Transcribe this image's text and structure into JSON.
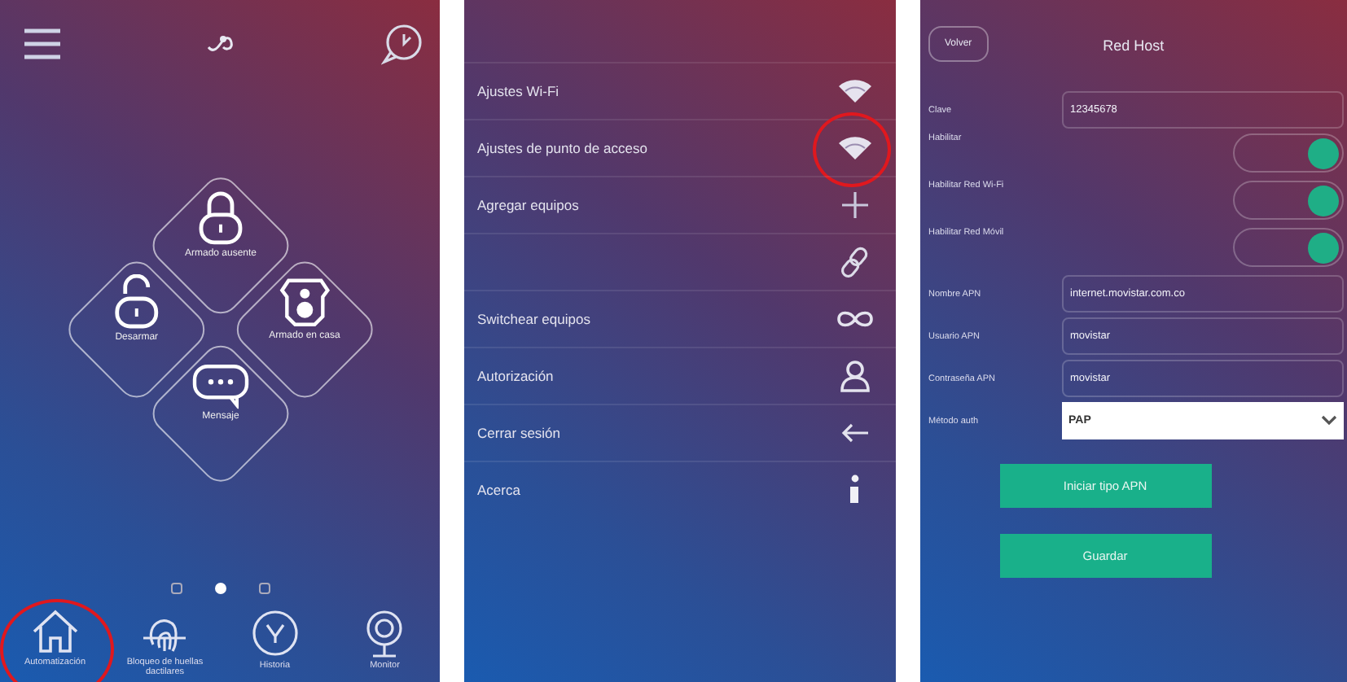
{
  "home": {
    "tiles": [
      {
        "label": "Armado ausente",
        "kind": "lock"
      },
      {
        "label": "Desarmar",
        "kind": "unlock"
      },
      {
        "label": "Armado en casa",
        "kind": "home-arm"
      },
      {
        "label": "Mensaje",
        "kind": "message"
      }
    ],
    "pager": [
      {
        "selected": false
      },
      {
        "selected": true
      },
      {
        "selected": false
      }
    ],
    "nav": [
      {
        "label": "Automatización",
        "kind": "home",
        "highlighted": true
      },
      {
        "label": "Bloqueo de huellas dactilares",
        "kind": "fingerprint",
        "highlighted": false
      },
      {
        "label": "Historia",
        "kind": "clock",
        "highlighted": false
      },
      {
        "label": "Monitor",
        "kind": "camera",
        "highlighted": false
      }
    ]
  },
  "menu": {
    "items": [
      {
        "label": "Ajustes Wi-Fi",
        "kind": "wifi",
        "highlighted": false
      },
      {
        "label": "Ajustes de punto de acceso",
        "kind": "wifi",
        "highlighted": true
      },
      {
        "label": "Agregar equipos",
        "kind": "plus",
        "highlighted": false
      },
      {
        "kind": "link",
        "highlighted": false
      },
      {
        "label": "Switchear equipos",
        "kind": "infinity",
        "highlighted": false
      },
      {
        "label": "Autorización",
        "kind": "user",
        "highlighted": false
      },
      {
        "label": "Cerrar sesión",
        "kind": "arrow",
        "highlighted": false
      },
      {
        "label": "Acerca",
        "kind": "info",
        "highlighted": false
      }
    ]
  },
  "host_form": {
    "back_button": "Volver",
    "title": "Red Host",
    "fields": [
      {
        "kind": "text",
        "label": "Clave",
        "value": "12345678"
      },
      {
        "kind": "toggle",
        "label": "Habilitar",
        "on": true
      },
      {
        "kind": "toggle",
        "label": "Habilitar Red Wi-Fi",
        "on": true
      },
      {
        "kind": "toggle",
        "label": "Habilitar Red Móvil",
        "on": true
      },
      {
        "kind": "text",
        "label": "Nombre APN",
        "value": "internet.movistar.com.co"
      },
      {
        "kind": "text",
        "label": "Usuario APN",
        "value": "movistar"
      },
      {
        "kind": "text",
        "label": "Contraseña APN",
        "value": "movistar"
      },
      {
        "kind": "select",
        "label": "Método auth",
        "value": "PAP"
      }
    ],
    "buttons": [
      "Iniciar tipo APN",
      "Guardar"
    ]
  }
}
